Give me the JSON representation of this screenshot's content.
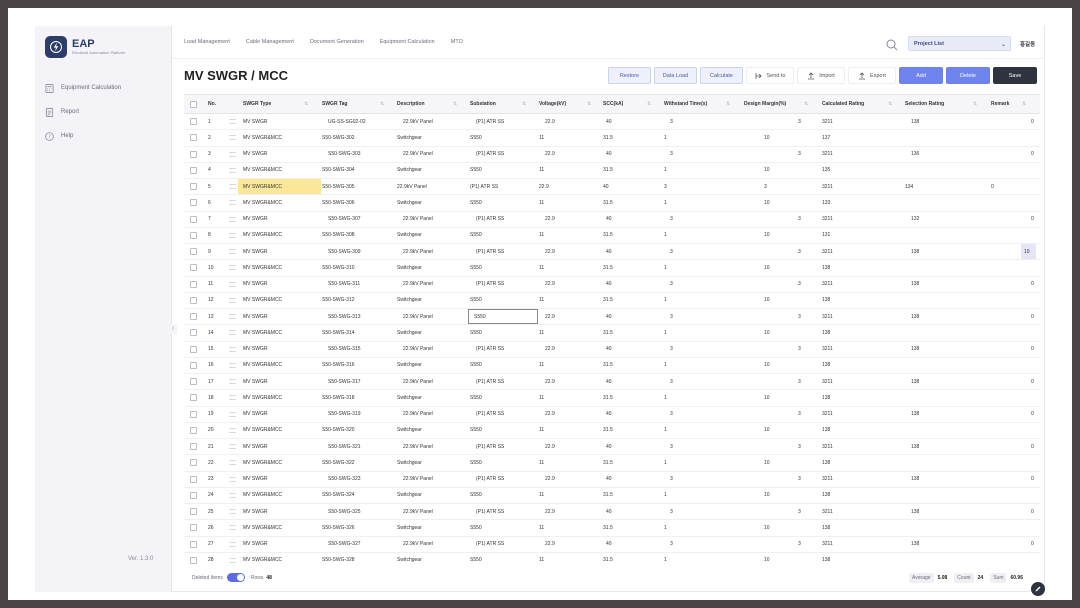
{
  "brand": {
    "title": "EAP",
    "subtitle": "Electrical Automation Platform"
  },
  "sidebar": {
    "items": [
      {
        "label": "Equipment Calculation",
        "icon": "calculator-icon"
      },
      {
        "label": "Report",
        "icon": "report-icon"
      },
      {
        "label": "Help",
        "icon": "help-icon"
      }
    ],
    "version": "Ver. 1.3.0"
  },
  "topnav": {
    "items": [
      "Load Management",
      "Cable Management",
      "Document Generation",
      "Equipment Calculation",
      "MTO"
    ],
    "project_select": "Project List",
    "user": "홍길동"
  },
  "page": {
    "title": "MV SWGR / MCC"
  },
  "toolbar": {
    "restore": "Restore",
    "data_load": "Data Load",
    "calculate": "Calculate",
    "send_to": "Send to",
    "import": "Import",
    "export": "Export",
    "add": "Add",
    "delete": "Delete",
    "save": "Save"
  },
  "columns": [
    "No.",
    "SWGR Type",
    "SWGR Tag",
    "Description",
    "Substation",
    "Voltage(kV)",
    "SCC(kA)",
    "Withstand Time(s)",
    "Design Margin(%)",
    "Calculated Rating",
    "Selection Rating",
    "Remark"
  ],
  "rows": [
    {
      "no": "1",
      "type": "MV SWGR",
      "tag": "UG-SS-SG02-02",
      "desc": "22.9kV Panel",
      "sub": "(P1) ATR SS",
      "volt": "22.9",
      "scc": "40",
      "wt": "3",
      "dm": "3",
      "calc": "3211",
      "sel": "138",
      "rem": "0"
    },
    {
      "no": "2",
      "type": "MV SWGR&MCC",
      "tag": "S50-SWG-302",
      "desc": "Switchgear",
      "sub": "S550",
      "volt": "11",
      "scc": "31.5",
      "wt": "1",
      "dm": "10",
      "calc": "137",
      "sel": "",
      "rem": ""
    },
    {
      "no": "3",
      "type": "MV SWGR",
      "tag": "S50-SWG-303",
      "desc": "22.9kV Panel",
      "sub": "(P1) ATR SS",
      "volt": "22.9",
      "scc": "40",
      "wt": "3",
      "dm": "3",
      "calc": "3211",
      "sel": "136",
      "rem": "0"
    },
    {
      "no": "4",
      "type": "MV SWGR&MCC",
      "tag": "S50-SWG-304",
      "desc": "Switchgear",
      "sub": "S550",
      "volt": "11",
      "scc": "31.5",
      "wt": "1",
      "dm": "10",
      "calc": "135",
      "sel": "",
      "rem": ""
    },
    {
      "no": "5",
      "type": "MV SWGR&MCC",
      "tag": "S50-SWG-305",
      "desc": "22.9kV Panel",
      "sub": "(P1) ATR SS",
      "volt": "22.9",
      "scc": "40",
      "wt": "3",
      "dm": "3",
      "calc": "3211",
      "sel": "134",
      "rem": "0"
    },
    {
      "no": "6",
      "type": "MV SWGR&MCC",
      "tag": "S50-SWG-306",
      "desc": "Switchgear",
      "sub": "S550",
      "volt": "11",
      "scc": "31.5",
      "wt": "1",
      "dm": "10",
      "calc": "133",
      "sel": "",
      "rem": ""
    },
    {
      "no": "7",
      "type": "MV SWGR",
      "tag": "S50-SWG-307",
      "desc": "22.9kV Panel",
      "sub": "(P1) ATR SS",
      "volt": "22.9",
      "scc": "40",
      "wt": "3",
      "dm": "3",
      "calc": "3211",
      "sel": "132",
      "rem": "0"
    },
    {
      "no": "8",
      "type": "MV SWGR&MCC",
      "tag": "S50-SWG-308",
      "desc": "Switchgear",
      "sub": "S550",
      "volt": "11",
      "scc": "31.5",
      "wt": "1",
      "dm": "10",
      "calc": "131",
      "sel": "",
      "rem": ""
    },
    {
      "no": "9",
      "type": "MV SWGR",
      "tag": "S50-SWG-309",
      "desc": "22.9kV Panel",
      "sub": "(P1) ATR SS",
      "volt": "22.9",
      "scc": "40",
      "wt": "3",
      "dm": "3",
      "calc": "3211",
      "sel": "138",
      "rem": "10"
    },
    {
      "no": "10",
      "type": "MV SWGR&MCC",
      "tag": "S50-SWG-310",
      "desc": "Switchgear",
      "sub": "S550",
      "volt": "11",
      "scc": "31.5",
      "wt": "1",
      "dm": "10",
      "calc": "138",
      "sel": "",
      "rem": ""
    },
    {
      "no": "11",
      "type": "MV SWGR",
      "tag": "S50-SWG-311",
      "desc": "22.9kV Panel",
      "sub": "(P1) ATR SS",
      "volt": "22.9",
      "scc": "40",
      "wt": "3",
      "dm": "3",
      "calc": "3211",
      "sel": "138",
      "rem": "0"
    },
    {
      "no": "12",
      "type": "MV SWGR&MCC",
      "tag": "S50-SWG-312",
      "desc": "Switchgear",
      "sub": "S550",
      "volt": "11",
      "scc": "31.5",
      "wt": "1",
      "dm": "10",
      "calc": "138",
      "sel": "",
      "rem": ""
    },
    {
      "no": "13",
      "type": "MV SWGR",
      "tag": "S50-SWG-313",
      "desc": "22.9kV Panel",
      "sub": "S550",
      "volt": "22.9",
      "scc": "40",
      "wt": "3",
      "dm": "3",
      "calc": "3211",
      "sel": "138",
      "rem": "0"
    },
    {
      "no": "14",
      "type": "MV SWGR&MCC",
      "tag": "S50-SWG-314",
      "desc": "Switchgear",
      "sub": "S550",
      "volt": "11",
      "scc": "31.5",
      "wt": "1",
      "dm": "10",
      "calc": "138",
      "sel": "",
      "rem": ""
    },
    {
      "no": "15",
      "type": "MV SWGR",
      "tag": "S50-SWG-315",
      "desc": "22.9kV Panel",
      "sub": "(P1) ATR SS",
      "volt": "22.9",
      "scc": "40",
      "wt": "3",
      "dm": "3",
      "calc": "3211",
      "sel": "138",
      "rem": "0"
    },
    {
      "no": "16",
      "type": "MV SWGR&MCC",
      "tag": "S50-SWG-316",
      "desc": "Switchgear",
      "sub": "S550",
      "volt": "11",
      "scc": "31.5",
      "wt": "1",
      "dm": "10",
      "calc": "138",
      "sel": "",
      "rem": ""
    },
    {
      "no": "17",
      "type": "MV SWGR",
      "tag": "S50-SWG-317",
      "desc": "22.9kV Panel",
      "sub": "(P1) ATR SS",
      "volt": "22.9",
      "scc": "40",
      "wt": "3",
      "dm": "3",
      "calc": "3211",
      "sel": "138",
      "rem": "0"
    },
    {
      "no": "18",
      "type": "MV SWGR&MCC",
      "tag": "S50-SWG-318",
      "desc": "Switchgear",
      "sub": "S550",
      "volt": "11",
      "scc": "31.5",
      "wt": "1",
      "dm": "10",
      "calc": "138",
      "sel": "",
      "rem": ""
    },
    {
      "no": "19",
      "type": "MV SWGR",
      "tag": "S50-SWG-319",
      "desc": "22.9kV Panel",
      "sub": "(P1) ATR SS",
      "volt": "22.9",
      "scc": "40",
      "wt": "3",
      "dm": "3",
      "calc": "3211",
      "sel": "138",
      "rem": "0"
    },
    {
      "no": "20",
      "type": "MV SWGR&MCC",
      "tag": "S50-SWG-320",
      "desc": "Switchgear",
      "sub": "S550",
      "volt": "11",
      "scc": "31.5",
      "wt": "1",
      "dm": "10",
      "calc": "138",
      "sel": "",
      "rem": ""
    },
    {
      "no": "21",
      "type": "MV SWGR",
      "tag": "S50-SWG-321",
      "desc": "22.9kV Panel",
      "sub": "(P1) ATR SS",
      "volt": "22.9",
      "scc": "40",
      "wt": "3",
      "dm": "3",
      "calc": "3211",
      "sel": "138",
      "rem": "0"
    },
    {
      "no": "22",
      "type": "MV SWGR&MCC",
      "tag": "S50-SWG-322",
      "desc": "Switchgear",
      "sub": "S550",
      "volt": "11",
      "scc": "31.5",
      "wt": "1",
      "dm": "10",
      "calc": "138",
      "sel": "",
      "rem": ""
    },
    {
      "no": "23",
      "type": "MV SWGR",
      "tag": "S50-SWG-323",
      "desc": "22.9kV Panel",
      "sub": "(P1) ATR SS",
      "volt": "22.9",
      "scc": "40",
      "wt": "3",
      "dm": "3",
      "calc": "3211",
      "sel": "138",
      "rem": "0"
    },
    {
      "no": "24",
      "type": "MV SWGR&MCC",
      "tag": "S50-SWG-324",
      "desc": "Switchgear",
      "sub": "S550",
      "volt": "11",
      "scc": "31.5",
      "wt": "1",
      "dm": "10",
      "calc": "138",
      "sel": "",
      "rem": ""
    },
    {
      "no": "25",
      "type": "MV SWGR",
      "tag": "S50-SWG-325",
      "desc": "22.9kV Panel",
      "sub": "(P1) ATR SS",
      "volt": "22.9",
      "scc": "40",
      "wt": "3",
      "dm": "3",
      "calc": "3211",
      "sel": "138",
      "rem": "0"
    },
    {
      "no": "26",
      "type": "MV SWGR&MCC",
      "tag": "S50-SWG-326",
      "desc": "Switchgear",
      "sub": "S550",
      "volt": "11",
      "scc": "31.5",
      "wt": "1",
      "dm": "10",
      "calc": "138",
      "sel": "",
      "rem": ""
    },
    {
      "no": "27",
      "type": "MV SWGR",
      "tag": "S50-SWG-327",
      "desc": "22.9kV Panel",
      "sub": "(P1) ATR SS",
      "volt": "22.9",
      "scc": "40",
      "wt": "3",
      "dm": "3",
      "calc": "3211",
      "sel": "138",
      "rem": "0"
    },
    {
      "no": "28",
      "type": "MV SWGR&MCC",
      "tag": "S50-SWG-328",
      "desc": "Switchgear",
      "sub": "S550",
      "volt": "11",
      "scc": "31.5",
      "wt": "1",
      "dm": "10",
      "calc": "138",
      "sel": "",
      "rem": ""
    }
  ],
  "highlights": {
    "yellow_row": "5",
    "edit_row": "13",
    "blue_row": "9"
  },
  "footer": {
    "deleted_items_label": "Deleted Items",
    "rows_label": "Rows",
    "rows_value": "48",
    "average_label": "Average",
    "average_value": "5.08",
    "count_label": "Count",
    "count_value": "24",
    "sum_label": "Sum",
    "sum_value": "60.96"
  },
  "colors": {
    "accent": "#6e84ec",
    "dark": "#2f3340",
    "highlight": "#fbe79a"
  }
}
